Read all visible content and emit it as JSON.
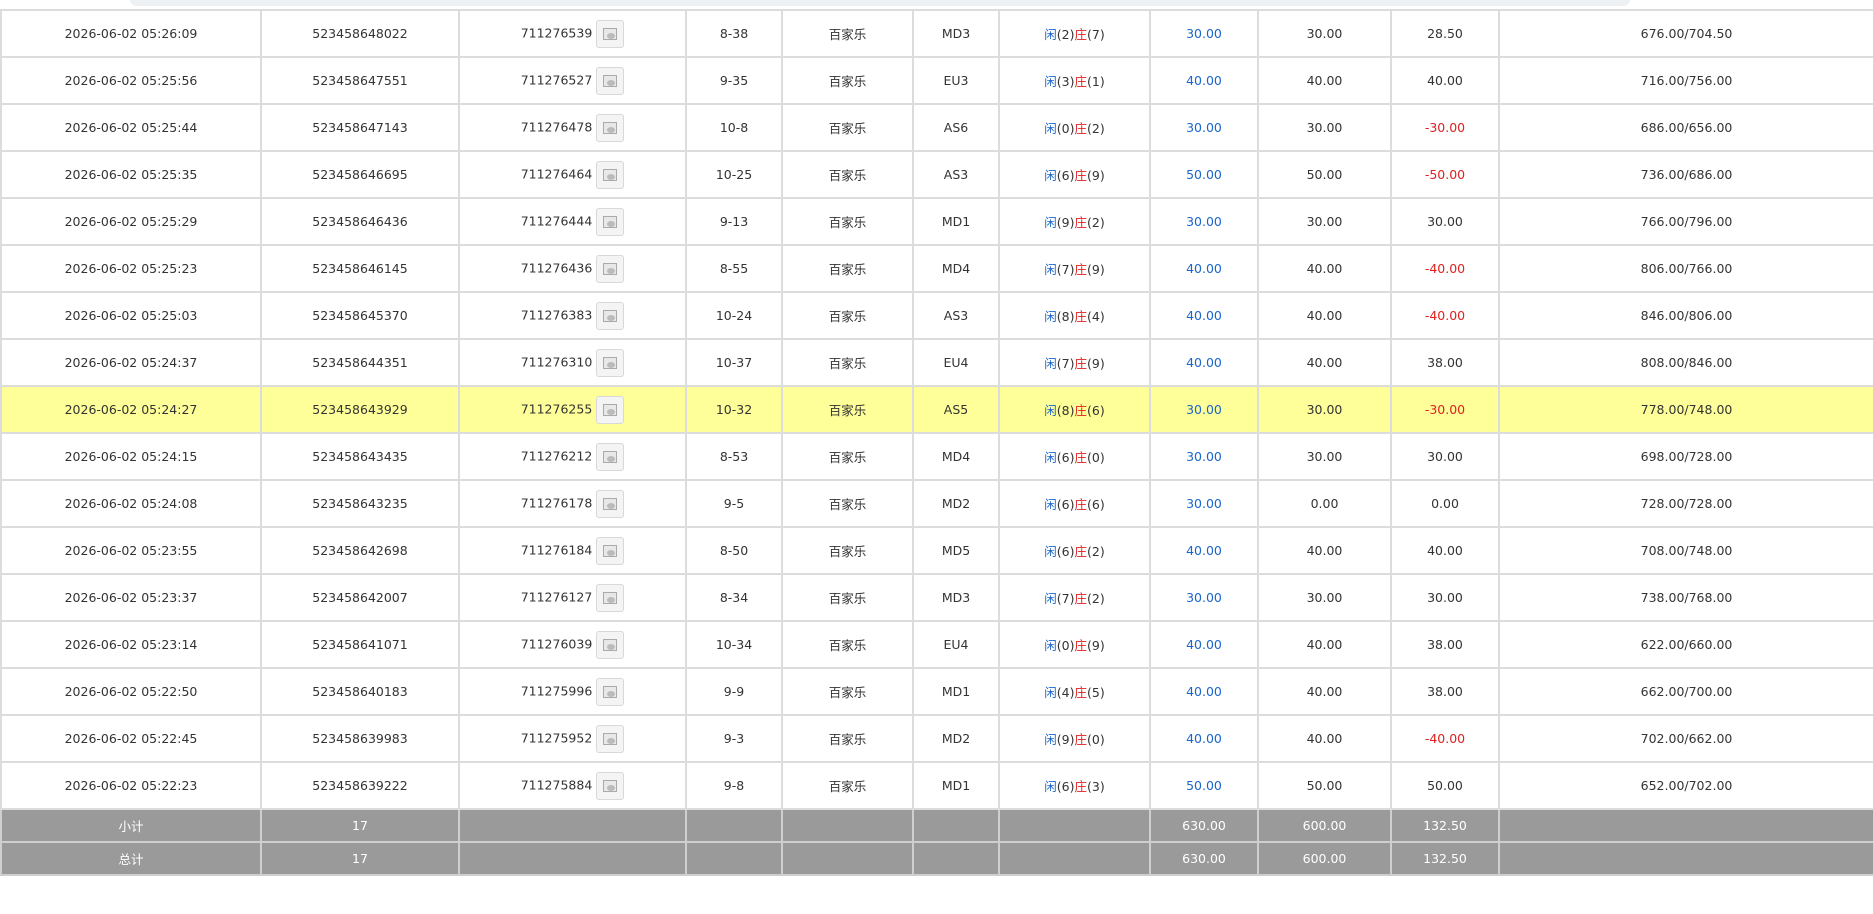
{
  "rows": [
    {
      "time": "2026-06-02 05:26:09",
      "order": "523458648022",
      "round": "711276539",
      "shoe": "8-38",
      "game": "百家乐",
      "table": "MD3",
      "p_label": "闲",
      "p": "(2)",
      "b_label": "庄",
      "b": "(7)",
      "bet": "30.00",
      "valid": "30.00",
      "win": "28.50",
      "win_color": "black",
      "balance": "676.00/704.50"
    },
    {
      "time": "2026-06-02 05:25:56",
      "order": "523458647551",
      "round": "711276527",
      "shoe": "9-35",
      "game": "百家乐",
      "table": "EU3",
      "p_label": "闲",
      "p": "(3)",
      "b_label": "庄",
      "b": "(1)",
      "bet": "40.00",
      "valid": "40.00",
      "win": "40.00",
      "win_color": "black",
      "balance": "716.00/756.00"
    },
    {
      "time": "2026-06-02 05:25:44",
      "order": "523458647143",
      "round": "711276478",
      "shoe": "10-8",
      "game": "百家乐",
      "table": "AS6",
      "p_label": "闲",
      "p": "(0)",
      "b_label": "庄",
      "b": "(2)",
      "bet": "30.00",
      "valid": "30.00",
      "win": "-30.00",
      "win_color": "red",
      "balance": "686.00/656.00"
    },
    {
      "time": "2026-06-02 05:25:35",
      "order": "523458646695",
      "round": "711276464",
      "shoe": "10-25",
      "game": "百家乐",
      "table": "AS3",
      "p_label": "闲",
      "p": "(6)",
      "b_label": "庄",
      "b": "(9)",
      "bet": "50.00",
      "valid": "50.00",
      "win": "-50.00",
      "win_color": "red",
      "balance": "736.00/686.00"
    },
    {
      "time": "2026-06-02 05:25:29",
      "order": "523458646436",
      "round": "711276444",
      "shoe": "9-13",
      "game": "百家乐",
      "table": "MD1",
      "p_label": "闲",
      "p": "(9)",
      "b_label": "庄",
      "b": "(2)",
      "bet": "30.00",
      "valid": "30.00",
      "win": "30.00",
      "win_color": "black",
      "balance": "766.00/796.00"
    },
    {
      "time": "2026-06-02 05:25:23",
      "order": "523458646145",
      "round": "711276436",
      "shoe": "8-55",
      "game": "百家乐",
      "table": "MD4",
      "p_label": "闲",
      "p": "(7)",
      "b_label": "庄",
      "b": "(9)",
      "bet": "40.00",
      "valid": "40.00",
      "win": "-40.00",
      "win_color": "red",
      "balance": "806.00/766.00"
    },
    {
      "time": "2026-06-02 05:25:03",
      "order": "523458645370",
      "round": "711276383",
      "shoe": "10-24",
      "game": "百家乐",
      "table": "AS3",
      "p_label": "闲",
      "p": "(8)",
      "b_label": "庄",
      "b": "(4)",
      "bet": "40.00",
      "valid": "40.00",
      "win": "-40.00",
      "win_color": "red",
      "balance": "846.00/806.00"
    },
    {
      "time": "2026-06-02 05:24:37",
      "order": "523458644351",
      "round": "711276310",
      "shoe": "10-37",
      "game": "百家乐",
      "table": "EU4",
      "p_label": "闲",
      "p": "(7)",
      "b_label": "庄",
      "b": "(9)",
      "bet": "40.00",
      "valid": "40.00",
      "win": "38.00",
      "win_color": "black",
      "balance": "808.00/846.00"
    },
    {
      "time": "2026-06-02 05:24:27",
      "order": "523458643929",
      "round": "711276255",
      "shoe": "10-32",
      "game": "百家乐",
      "table": "AS5",
      "p_label": "闲",
      "p": "(8)",
      "b_label": "庄",
      "b": "(6)",
      "bet": "30.00",
      "valid": "30.00",
      "win": "-30.00",
      "win_color": "red",
      "balance": "778.00/748.00",
      "highlight": true
    },
    {
      "time": "2026-06-02 05:24:15",
      "order": "523458643435",
      "round": "711276212",
      "shoe": "8-53",
      "game": "百家乐",
      "table": "MD4",
      "p_label": "闲",
      "p": "(6)",
      "b_label": "庄",
      "b": "(0)",
      "bet": "30.00",
      "valid": "30.00",
      "win": "30.00",
      "win_color": "black",
      "balance": "698.00/728.00"
    },
    {
      "time": "2026-06-02 05:24:08",
      "order": "523458643235",
      "round": "711276178",
      "shoe": "9-5",
      "game": "百家乐",
      "table": "MD2",
      "p_label": "闲",
      "p": "(6)",
      "b_label": "庄",
      "b": "(6)",
      "bet": "30.00",
      "valid": "0.00",
      "win": "0.00",
      "win_color": "black",
      "balance": "728.00/728.00"
    },
    {
      "time": "2026-06-02 05:23:55",
      "order": "523458642698",
      "round": "711276184",
      "shoe": "8-50",
      "game": "百家乐",
      "table": "MD5",
      "p_label": "闲",
      "p": "(6)",
      "b_label": "庄",
      "b": "(2)",
      "bet": "40.00",
      "valid": "40.00",
      "win": "40.00",
      "win_color": "black",
      "balance": "708.00/748.00"
    },
    {
      "time": "2026-06-02 05:23:37",
      "order": "523458642007",
      "round": "711276127",
      "shoe": "8-34",
      "game": "百家乐",
      "table": "MD3",
      "p_label": "闲",
      "p": "(7)",
      "b_label": "庄",
      "b": "(2)",
      "bet": "30.00",
      "valid": "30.00",
      "win": "30.00",
      "win_color": "black",
      "balance": "738.00/768.00"
    },
    {
      "time": "2026-06-02 05:23:14",
      "order": "523458641071",
      "round": "711276039",
      "shoe": "10-34",
      "game": "百家乐",
      "table": "EU4",
      "p_label": "闲",
      "p": "(0)",
      "b_label": "庄",
      "b": "(9)",
      "bet": "40.00",
      "valid": "40.00",
      "win": "38.00",
      "win_color": "black",
      "balance": "622.00/660.00"
    },
    {
      "time": "2026-06-02 05:22:50",
      "order": "523458640183",
      "round": "711275996",
      "shoe": "9-9",
      "game": "百家乐",
      "table": "MD1",
      "p_label": "闲",
      "p": "(4)",
      "b_label": "庄",
      "b": "(5)",
      "bet": "40.00",
      "valid": "40.00",
      "win": "38.00",
      "win_color": "black",
      "balance": "662.00/700.00"
    },
    {
      "time": "2026-06-02 05:22:45",
      "order": "523458639983",
      "round": "711275952",
      "shoe": "9-3",
      "game": "百家乐",
      "table": "MD2",
      "p_label": "闲",
      "p": "(9)",
      "b_label": "庄",
      "b": "(0)",
      "bet": "40.00",
      "valid": "40.00",
      "win": "-40.00",
      "win_color": "red",
      "balance": "702.00/662.00"
    },
    {
      "time": "2026-06-02 05:22:23",
      "order": "523458639222",
      "round": "711275884",
      "shoe": "9-8",
      "game": "百家乐",
      "table": "MD1",
      "p_label": "闲",
      "p": "(6)",
      "b_label": "庄",
      "b": "(3)",
      "bet": "50.00",
      "valid": "50.00",
      "win": "50.00",
      "win_color": "black",
      "balance": "652.00/702.00"
    }
  ],
  "subtotal": {
    "label": "小计",
    "count": "17",
    "bet": "630.00",
    "valid": "600.00",
    "win": "132.50"
  },
  "total": {
    "label": "总计",
    "count": "17",
    "bet": "630.00",
    "valid": "600.00",
    "win": "132.50"
  },
  "colors": {
    "highlight": "#ffff99",
    "summary_bg": "#9a9a9a",
    "blue": "#1a66cc",
    "red": "#e02020"
  },
  "icons": {
    "round_detail": "image-icon"
  }
}
